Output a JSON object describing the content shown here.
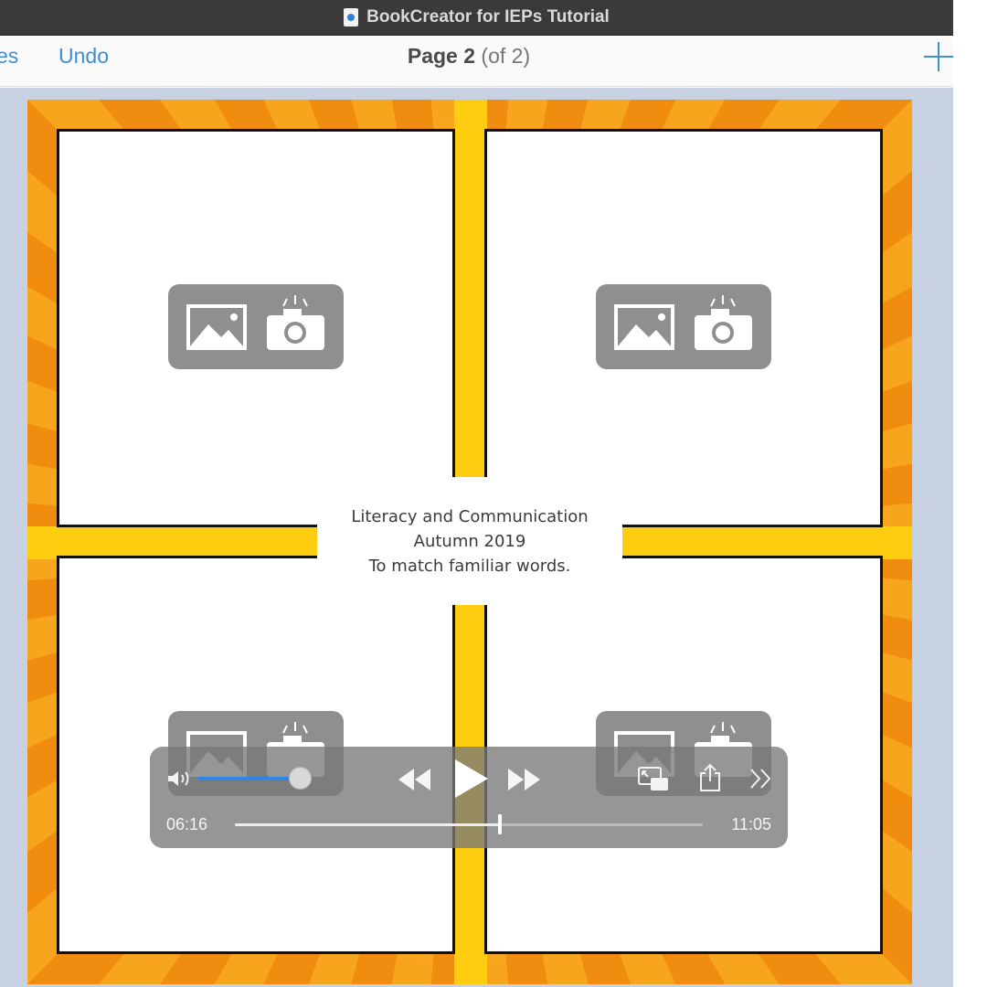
{
  "titlebar": {
    "title": "BookCreator for IEPs Tutorial",
    "icon": "document-icon"
  },
  "navbar": {
    "back_label": "es",
    "undo_label": "Undo",
    "page_word": "Page 2",
    "page_total": "(of 2)",
    "add_icon": "plus-icon",
    "accent": "#3d8fd6"
  },
  "page": {
    "caption_line1": "Literacy and Communication",
    "caption_line2": "Autumn 2019",
    "caption_line3": "To match familiar words.",
    "placeholders": [
      "image-icon",
      "camera-icon"
    ],
    "colors": {
      "sunburst": "#f08c10",
      "cross": "#ffcd10",
      "panel": "#ffffff"
    }
  },
  "player": {
    "elapsed": "06:16",
    "total": "11:05",
    "progress": 0.567,
    "volume": 0.92,
    "icons": [
      "volume-icon",
      "rewind-icon",
      "play-icon",
      "fast-forward-icon",
      "picture-in-picture-icon",
      "share-icon",
      "more-icon"
    ]
  }
}
